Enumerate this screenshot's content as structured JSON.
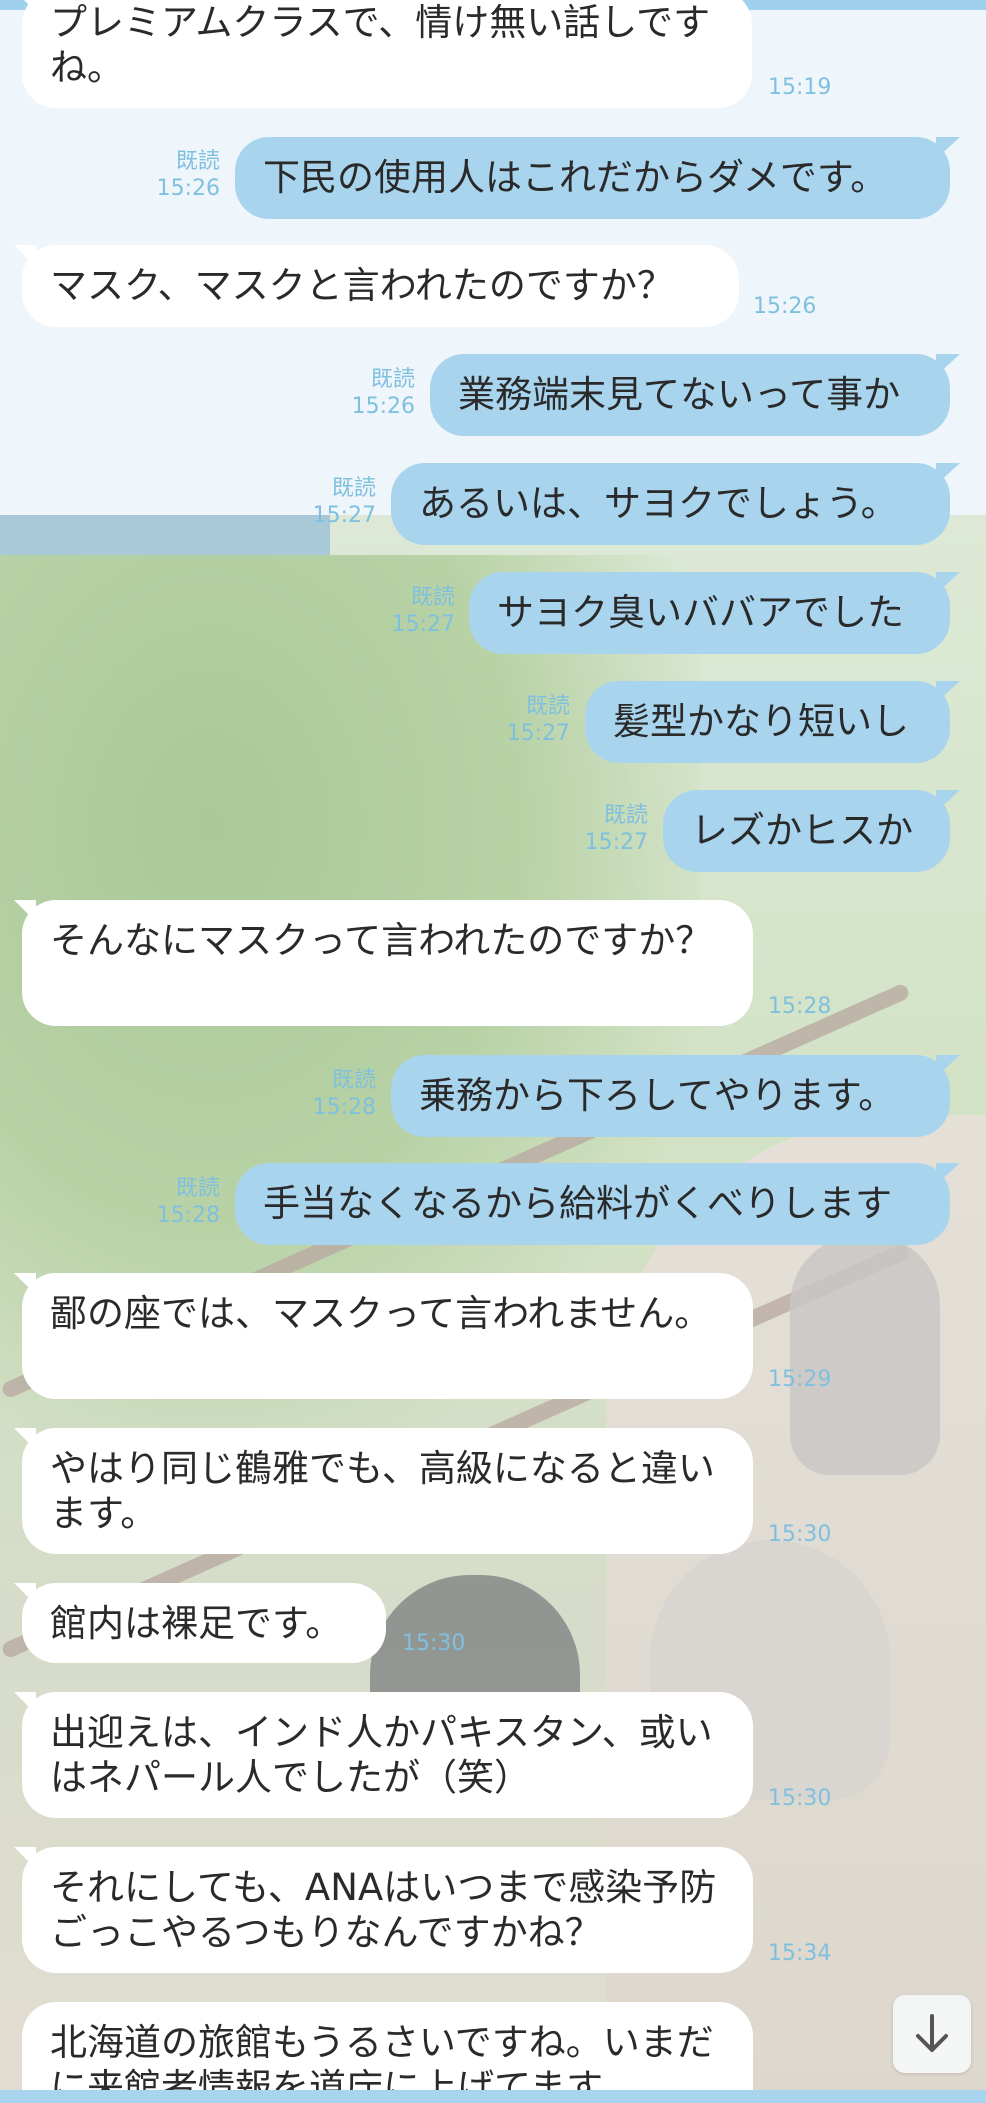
{
  "messages": [
    {
      "side": "in",
      "text": "プレミアムクラスで、情け無い話しですね。",
      "time": "15:19"
    },
    {
      "side": "out",
      "read": "既読",
      "time": "15:26",
      "text": "下民の使用人はこれだからダメです。"
    },
    {
      "side": "in",
      "text": "マスク、マスクと言われたのですか？",
      "time": "15:26"
    },
    {
      "side": "out",
      "read": "既読",
      "time": "15:26",
      "text": "業務端末見てないって事か"
    },
    {
      "side": "out",
      "read": "既読",
      "time": "15:27",
      "text": "あるいは、サヨクでしょう。"
    },
    {
      "side": "out",
      "read": "既読",
      "time": "15:27",
      "text": "サヨク臭いババアでした"
    },
    {
      "side": "out",
      "read": "既読",
      "time": "15:27",
      "text": "髪型かなり短いし"
    },
    {
      "side": "out",
      "read": "既読",
      "time": "15:27",
      "text": "レズかヒスか"
    },
    {
      "side": "in",
      "text": "そんなにマスクって言われたのですか？",
      "time": "15:28"
    },
    {
      "side": "out",
      "read": "既読",
      "time": "15:28",
      "text": "乗務から下ろしてやります。"
    },
    {
      "side": "out",
      "read": "既読",
      "time": "15:28",
      "text": "手当なくなるから給料がくべりします"
    },
    {
      "side": "in",
      "text": "鄙の座では、マスクって言われません。",
      "time": "15:29"
    },
    {
      "side": "in",
      "text": "やはり同じ鶴雅でも、高級になると違います。",
      "time": "15:30"
    },
    {
      "side": "in",
      "text": "館内は裸足です。",
      "time": "15:30"
    },
    {
      "side": "in",
      "text": "出迎えは、インド人かパキスタン、或いはネパール人でしたが（笑）",
      "time": "15:30"
    },
    {
      "side": "in",
      "text": "それにしても、ANAはいつまで感染予防ごっこやるつもりなんですかね？",
      "time": "15:34"
    },
    {
      "side": "in",
      "text": "北海道の旅館もうるさいですね。いまだに来館者情報を道庁に上げてます",
      "time": ""
    }
  ],
  "icons": {
    "scroll_down": "arrow-down-icon"
  },
  "colors": {
    "incoming_bubble": "#ffffff",
    "outgoing_bubble": "#a9d4ee",
    "meta_text": "#7fc0df",
    "header_accent": "#9fd0ec"
  }
}
